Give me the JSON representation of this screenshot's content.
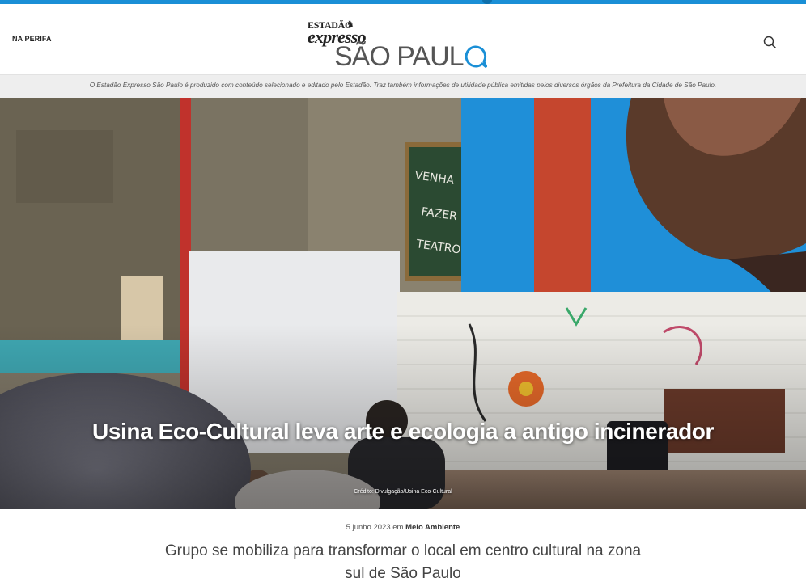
{
  "header": {
    "section_label": "NA PERIFA",
    "logo_estadao": "ESTADÃO",
    "logo_expresso": "expresso",
    "logo_city": "SÃO PAULO",
    "search_icon": "search-icon"
  },
  "disclaimer": "O Estadão Expresso São Paulo é produzido com conteúdo selecionado e editado pelo Estadão. Traz também informações de utilidade pública emitidas pelos diversos órgãos da Prefeitura da Cidade de São Paulo.",
  "hero": {
    "title": "Usina Eco-Cultural leva arte e ecologia a antigo incinerador",
    "credit": "Crédito: Divulgação/Usina Eco-Cultural",
    "chalkboard_text": [
      "VENHA",
      "FAZER",
      "TEATRO!"
    ]
  },
  "article": {
    "date": "5 junho 2023",
    "date_sep": "em",
    "category": "Meio Ambiente",
    "subtitle": "Grupo se mobiliza para transformar o local em centro cultural na zona sul de São Paulo"
  },
  "colors": {
    "accent_blue": "#1a8fd6",
    "disclaimer_bg": "#eeeeee"
  }
}
